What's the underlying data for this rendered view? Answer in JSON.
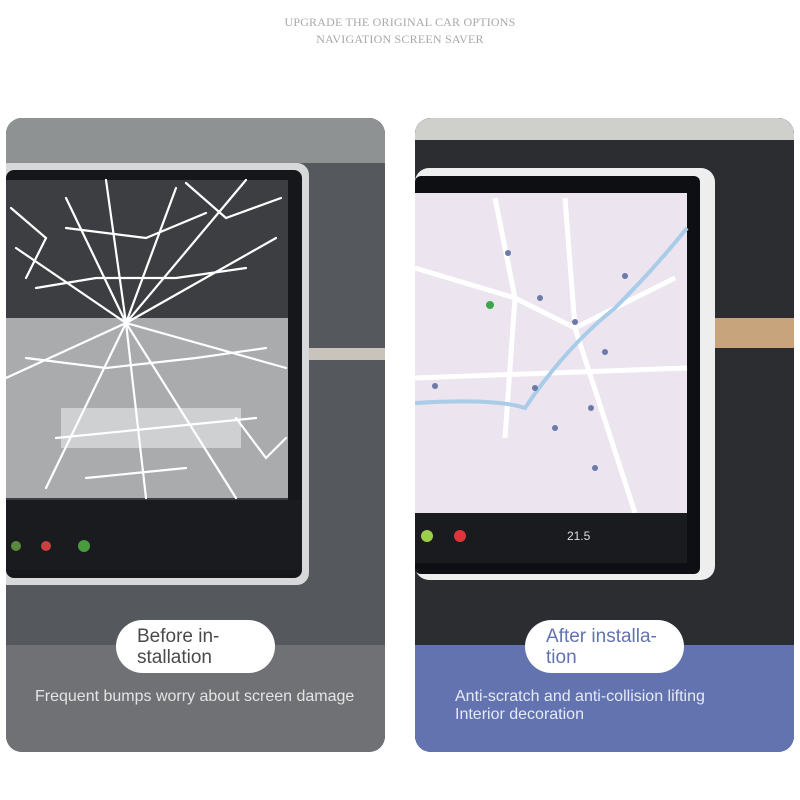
{
  "header": {
    "line1": "UPGRADE THE ORIGINAL CAR OPTIONS",
    "line2": "NAVIGATION SCREEN SAVER"
  },
  "before": {
    "label": "Before installation",
    "label_line1": "Before in-",
    "label_line2": "stallation",
    "description": "Frequent bumps worry about screen damage"
  },
  "after": {
    "label": "After installation",
    "label_line1": "After installa-",
    "label_line2": "tion",
    "description_line1": "Anti-scratch and anti-collision lifting",
    "description_line2": "Interior decoration",
    "temperature": "21.5"
  },
  "colors": {
    "before_band": "#707174",
    "after_band": "#6273b0",
    "header_text": "#a8a8a8"
  }
}
